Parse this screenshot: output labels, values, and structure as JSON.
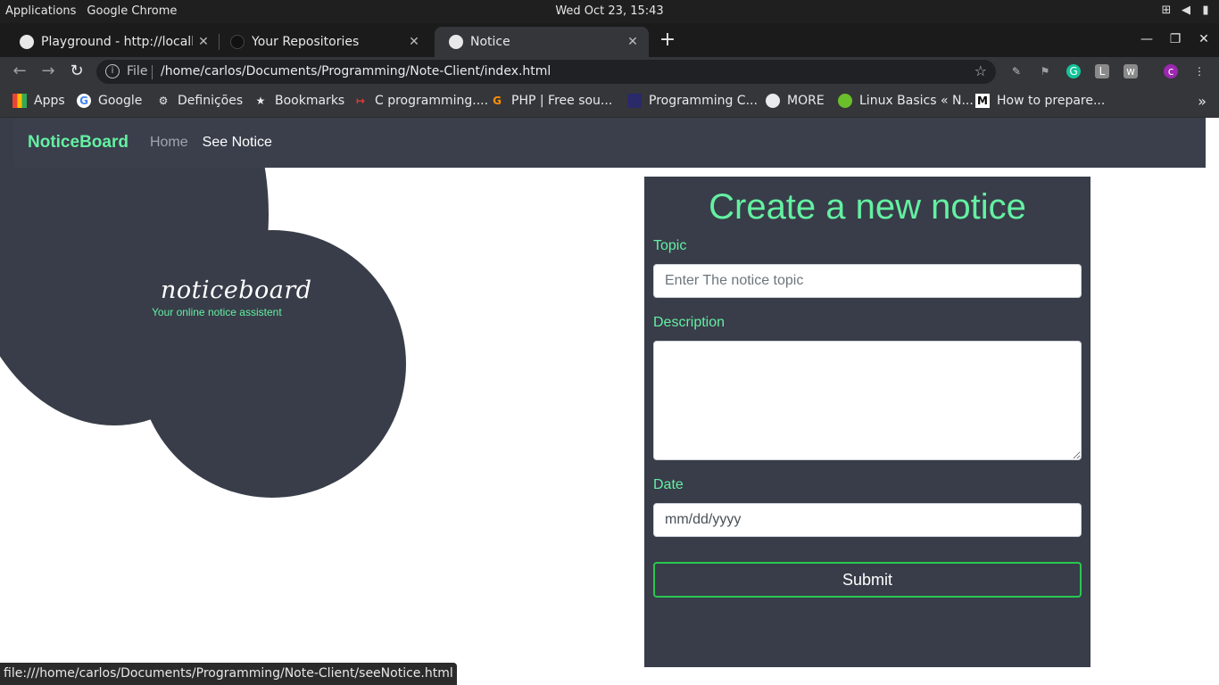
{
  "os_bar": {
    "applications": "Applications",
    "app_name": "Google Chrome",
    "clock": "Wed Oct 23, 15:43"
  },
  "tabs": [
    {
      "label": "Playground - http://localho",
      "icon": "globe-icon"
    },
    {
      "label": "Your Repositories",
      "icon": "github-icon"
    },
    {
      "label": "Notice",
      "icon": "globe-icon",
      "active": true
    }
  ],
  "toolbar": {
    "scheme": "File",
    "url": "/home/carlos/Documents/Programming/Note-Client/index.html"
  },
  "bookmarks": [
    {
      "label": "Apps",
      "icon": "apps-grid-icon"
    },
    {
      "label": "Google",
      "icon": "google-icon"
    },
    {
      "label": "Definições",
      "icon": "gear-icon"
    },
    {
      "label": "Bookmarks",
      "icon": "star-icon"
    },
    {
      "label": "C programming....",
      "icon": "c-icon"
    },
    {
      "label": "PHP | Free sou...",
      "icon": "php-icon"
    },
    {
      "label": "Programming C...",
      "icon": "bookmark-icon"
    },
    {
      "label": "MORE",
      "icon": "globe-icon"
    },
    {
      "label": "Linux Basics « N...",
      "icon": "linux-icon"
    },
    {
      "label": "How to prepare...",
      "icon": "medium-icon"
    }
  ],
  "site": {
    "brand": "NoticeBoard",
    "nav": {
      "home": "Home",
      "see_notice": "See Notice"
    },
    "logo_script": "noticeboard",
    "logo_tagline": "Your online notice assistent"
  },
  "form": {
    "title": "Create a new notice",
    "topic_label": "Topic",
    "topic_placeholder": "Enter The notice topic",
    "description_label": "Description",
    "date_label": "Date",
    "date_value": "mm/dd/yyyy",
    "submit_label": "Submit"
  },
  "status_bar": {
    "link_url": "file:///home/carlos/Documents/Programming/Note-Client/seeNotice.html"
  },
  "colors": {
    "accent_green": "#64f0a2",
    "panel_dark": "#383d49",
    "navbar": "#3a3f4b",
    "submit_border": "#28c850"
  }
}
